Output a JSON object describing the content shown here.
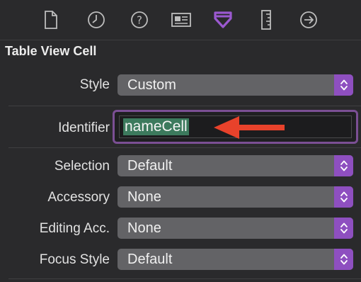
{
  "toolbar": {
    "icons": [
      {
        "name": "file-inspector-icon",
        "selected": false
      },
      {
        "name": "history-inspector-icon",
        "selected": false
      },
      {
        "name": "quick-help-icon",
        "selected": false
      },
      {
        "name": "identity-inspector-icon",
        "selected": false
      },
      {
        "name": "attributes-inspector-icon",
        "selected": true
      },
      {
        "name": "size-inspector-icon",
        "selected": false
      },
      {
        "name": "connections-inspector-icon",
        "selected": false
      }
    ],
    "selected_color": "#9b59d0"
  },
  "section": {
    "title": "Table View Cell"
  },
  "fields": {
    "style": {
      "label": "Style",
      "value": "Custom"
    },
    "identifier": {
      "label": "Identifier",
      "value": "nameCell"
    },
    "selection": {
      "label": "Selection",
      "value": "Default"
    },
    "accessory": {
      "label": "Accessory",
      "value": "None"
    },
    "editing_acc": {
      "label": "Editing Acc.",
      "value": "None"
    },
    "focus_style": {
      "label": "Focus Style",
      "value": "Default"
    }
  },
  "annotation": {
    "arrow_color": "#e8422b"
  }
}
